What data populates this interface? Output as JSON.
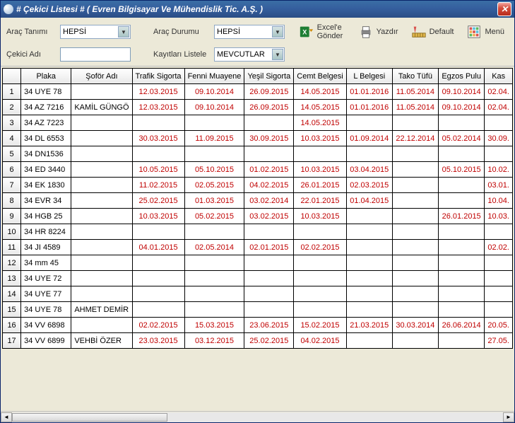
{
  "window": {
    "title": "# Çekici Listesi #  ( Evren Bilgisayar Ve Mühendislik Tic. A.Ş. )"
  },
  "filters": {
    "arac_tanimi_label": "Araç Tanımı",
    "arac_tanimi_value": "HEPSİ",
    "cekici_adi_label": "Çekici Adı",
    "cekici_adi_value": "",
    "arac_durumu_label": "Araç Durumu",
    "arac_durumu_value": "HEPSİ",
    "kayitlari_listele_label": "Kayıtları Listele",
    "kayitlari_listele_value": "MEVCUTLAR"
  },
  "buttons": {
    "excel": "Excel'e Gönder",
    "yazdir": "Yazdır",
    "default": "Default",
    "menu": "Menü"
  },
  "columns": [
    "Plaka",
    "Şoför Adı",
    "Trafik Sigorta",
    "Fenni Muayene",
    "Yeşil Sigorta",
    "Cemt Belgesi",
    "L Belgesi",
    "Tako Tüfü",
    "Egzos Pulu",
    "Kas"
  ],
  "rows": [
    {
      "n": "1",
      "plaka": "34  UYE 78",
      "sofor": "",
      "trafik": "12.03.2015",
      "fenni": "09.10.2014",
      "yesil": "26.09.2015",
      "cemt": "14.05.2015",
      "lbel": "01.01.2016",
      "tako": "11.05.2014",
      "egzos": "09.10.2014",
      "kas": "02.04."
    },
    {
      "n": "2",
      "plaka": "34 AZ 7216",
      "sofor": "KAMİL GÜNGÖ",
      "trafik": "12.03.2015",
      "fenni": "09.10.2014",
      "yesil": "26.09.2015",
      "cemt": "14.05.2015",
      "lbel": "01.01.2016",
      "tako": "11.05.2014",
      "egzos": "09.10.2014",
      "kas": "02.04."
    },
    {
      "n": "3",
      "plaka": "34 AZ 7223",
      "sofor": "",
      "trafik": "",
      "fenni": "",
      "yesil": "",
      "cemt": "14.05.2015",
      "lbel": "",
      "tako": "",
      "egzos": "",
      "kas": ""
    },
    {
      "n": "4",
      "plaka": "34 DL 6553",
      "sofor": "",
      "trafik": "30.03.2015",
      "fenni": "11.09.2015",
      "yesil": "30.09.2015",
      "cemt": "10.03.2015",
      "lbel": "01.09.2014",
      "tako": "22.12.2014",
      "egzos": "05.02.2014",
      "kas": "30.09."
    },
    {
      "n": "5",
      "plaka": "34 DN1536",
      "sofor": "",
      "trafik": "",
      "fenni": "",
      "yesil": "",
      "cemt": "",
      "lbel": "",
      "tako": "",
      "egzos": "",
      "kas": ""
    },
    {
      "n": "6",
      "plaka": "34 ED 3440",
      "sofor": "",
      "trafik": "10.05.2015",
      "fenni": "05.10.2015",
      "yesil": "01.02.2015",
      "cemt": "10.03.2015",
      "lbel": "03.04.2015",
      "tako": "",
      "egzos": "05.10.2015",
      "kas": "10.02."
    },
    {
      "n": "7",
      "plaka": "34 EK 1830",
      "sofor": "",
      "trafik": "11.02.2015",
      "fenni": "02.05.2015",
      "yesil": "04.02.2015",
      "cemt": "26.01.2015",
      "lbel": "02.03.2015",
      "tako": "",
      "egzos": "",
      "kas": "03.01."
    },
    {
      "n": "8",
      "plaka": "34 EVR 34",
      "sofor": "",
      "trafik": "25.02.2015",
      "fenni": "01.03.2015",
      "yesil": "03.02.2014",
      "cemt": "22.01.2015",
      "lbel": "01.04.2015",
      "tako": "",
      "egzos": "",
      "kas": "10.04."
    },
    {
      "n": "9",
      "plaka": "34 HGB 25",
      "sofor": "",
      "trafik": "10.03.2015",
      "fenni": "05.02.2015",
      "yesil": "03.02.2015",
      "cemt": "10.03.2015",
      "lbel": "",
      "tako": "",
      "egzos": "26.01.2015",
      "kas": "10.03."
    },
    {
      "n": "10",
      "plaka": "34 HR 8224",
      "sofor": "",
      "trafik": "",
      "fenni": "",
      "yesil": "",
      "cemt": "",
      "lbel": "",
      "tako": "",
      "egzos": "",
      "kas": ""
    },
    {
      "n": "11",
      "plaka": "34 JI 4589",
      "sofor": "",
      "trafik": "04.01.2015",
      "fenni": "02.05.2014",
      "yesil": "02.01.2015",
      "cemt": "02.02.2015",
      "lbel": "",
      "tako": "",
      "egzos": "",
      "kas": "02.02."
    },
    {
      "n": "12",
      "plaka": "34 mm 45",
      "sofor": "",
      "trafik": "",
      "fenni": "",
      "yesil": "",
      "cemt": "",
      "lbel": "",
      "tako": "",
      "egzos": "",
      "kas": ""
    },
    {
      "n": "13",
      "plaka": "34 UYE 72",
      "sofor": "",
      "trafik": "",
      "fenni": "",
      "yesil": "",
      "cemt": "",
      "lbel": "",
      "tako": "",
      "egzos": "",
      "kas": ""
    },
    {
      "n": "14",
      "plaka": "34 UYE 77",
      "sofor": "",
      "trafik": "",
      "fenni": "",
      "yesil": "",
      "cemt": "",
      "lbel": "",
      "tako": "",
      "egzos": "",
      "kas": ""
    },
    {
      "n": "15",
      "plaka": "34 UYE 78",
      "sofor": "AHMET DEMİR",
      "trafik": "",
      "fenni": "",
      "yesil": "",
      "cemt": "",
      "lbel": "",
      "tako": "",
      "egzos": "",
      "kas": ""
    },
    {
      "n": "16",
      "plaka": "34 VV 6898",
      "sofor": "",
      "trafik": "02.02.2015",
      "fenni": "15.03.2015",
      "yesil": "23.06.2015",
      "cemt": "15.02.2015",
      "lbel": "21.03.2015",
      "tako": "30.03.2014",
      "egzos": "26.06.2014",
      "kas": "20.05."
    },
    {
      "n": "17",
      "plaka": "34 VV 6899",
      "sofor": "VEHBİ ÖZER",
      "trafik": "23.03.2015",
      "fenni": "03.12.2015",
      "yesil": "25.02.2015",
      "cemt": "04.02.2015",
      "lbel": "",
      "tako": "",
      "egzos": "",
      "kas": "27.05."
    }
  ]
}
